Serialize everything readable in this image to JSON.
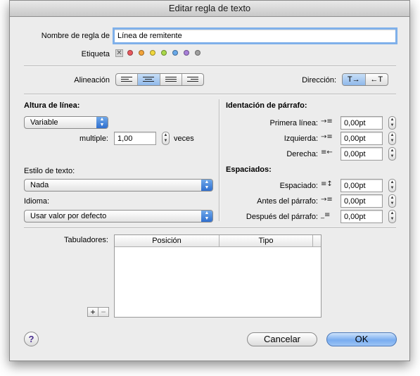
{
  "window": {
    "title": "Editar regla de texto"
  },
  "rule_name": {
    "label": "Nombre de regla de",
    "value": "Línea de remitente"
  },
  "tag": {
    "label": "Etiqueta",
    "clear_symbol": "✕",
    "colors": [
      "#e8585e",
      "#f2a33a",
      "#f0d73d",
      "#a9d84a",
      "#68a8e8",
      "#a77fd8",
      "#a0a0a0"
    ]
  },
  "alignment": {
    "label": "Alineación",
    "options": [
      "left",
      "center",
      "justify",
      "right"
    ],
    "selected": "center"
  },
  "direction": {
    "label": "Dirección:",
    "ltr": "T→",
    "rtl": "←T"
  },
  "line_height": {
    "heading": "Altura de línea:",
    "mode": "Variable",
    "multiple_label": "multiple:",
    "multiple_value": "1,00",
    "unit": "veces"
  },
  "text_style": {
    "label": "Estilo de texto:",
    "value": "Nada"
  },
  "language": {
    "label": "Idioma:",
    "value": "Usar valor por defecto"
  },
  "indent": {
    "heading": "Identación de párrafo:",
    "first_line": {
      "label": "Primera línea:",
      "value": "0,00pt"
    },
    "left": {
      "label": "Izquierda:",
      "value": "0,00pt"
    },
    "right": {
      "label": "Derecha:",
      "value": "0,00pt"
    }
  },
  "spacing": {
    "heading": "Espaciados:",
    "line": {
      "label": "Espaciado:",
      "value": "0,00pt"
    },
    "before": {
      "label": "Antes del párrafo:",
      "value": "0,00pt"
    },
    "after": {
      "label": "Después del párrafo:",
      "value": "0,00pt"
    }
  },
  "tabs": {
    "label": "Tabuladores:",
    "columns": [
      "Posición",
      "Tipo"
    ],
    "add": "+",
    "remove": "−"
  },
  "buttons": {
    "help": "?",
    "cancel": "Cancelar",
    "ok": "OK"
  }
}
